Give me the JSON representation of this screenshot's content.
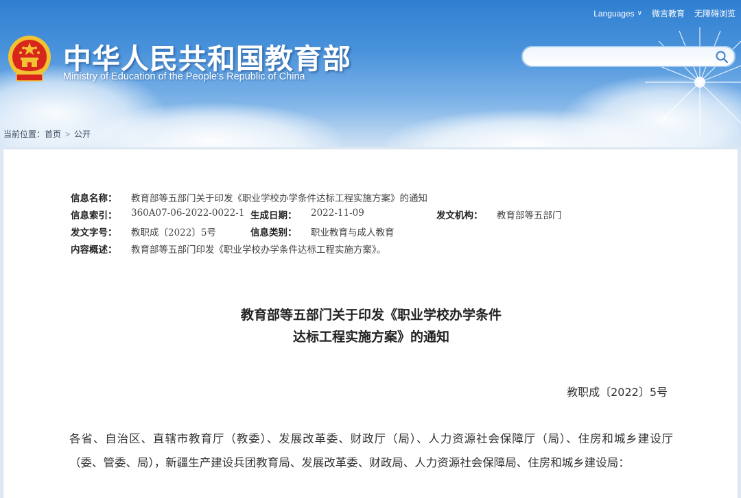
{
  "header": {
    "title_cn": "中华人民共和国教育部",
    "title_en": "Ministry of Education of the People's Republic of China",
    "links": {
      "languages": "Languages",
      "weibo": "微言教育",
      "accessibility": "无障碍浏览"
    },
    "search": {
      "value": "",
      "placeholder": ""
    },
    "colors": {
      "banner_top": "#2f7fd0",
      "banner_bottom": "#cfe2f4",
      "emblem_red": "#d8261c",
      "emblem_gold": "#f2c230"
    }
  },
  "breadcrumb": {
    "label": "当前位置：",
    "home": "首页",
    "separator": ">",
    "current": "公开"
  },
  "meta": {
    "name_label": "信息名称：",
    "name_value": "教育部等五部门关于印发《职业学校办学条件达标工程实施方案》的通知",
    "index_label": "信息索引：",
    "index_value": "360A07-06-2022-0022-1",
    "date_label": "生成日期：",
    "date_value": "2022-11-09",
    "org_label": "发文机构：",
    "org_value": "教育部等五部门",
    "docno_label": "发文字号：",
    "docno_value": "教职成〔2022〕5号",
    "category_label": "信息类别：",
    "category_value": "职业教育与成人教育",
    "summary_label": "内容概述：",
    "summary_value": "教育部等五部门印发《职业学校办学条件达标工程实施方案》。"
  },
  "document": {
    "title_line1": "教育部等五部门关于印发《职业学校办学条件",
    "title_line2": "达标工程实施方案》的通知",
    "number": "教职成〔2022〕5号",
    "body": "各省、自治区、直辖市教育厅（教委）、发展改革委、财政厅（局）、人力资源社会保障厅（局）、住房和城乡建设厅（委、管委、局），新疆生产建设兵团教育局、发展改革委、财政局、人力资源社会保障局、住房和城乡建设局："
  }
}
